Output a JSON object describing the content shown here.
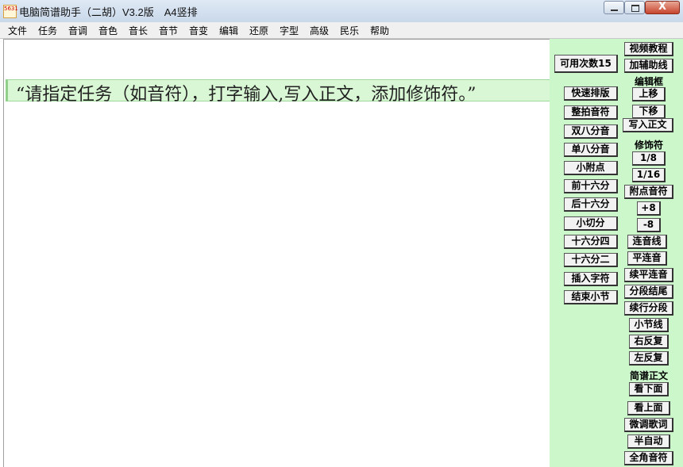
{
  "window": {
    "icon_text": "5631",
    "title": "电脑简谱助手（二胡）V3.2版　A4竖排",
    "close_glyph": "X"
  },
  "menu": [
    "文件",
    "任务",
    "音调",
    "音色",
    "音长",
    "音节",
    "音变",
    "编辑",
    "还原",
    "字型",
    "高级",
    "民乐",
    "帮助"
  ],
  "editor": {
    "prompt": "“请指定任务（如音符），打字输入,写入正文，添加修饰符。”"
  },
  "panel": {
    "left_buttons": [
      "可用次数15",
      "快速排版",
      "整拍音符",
      "双八分音",
      "单八分音",
      "小附点",
      "前十六分",
      "后十六分",
      "小切分",
      "十六分四",
      "十六分二",
      "插入字符",
      "结束小节"
    ],
    "right_items": [
      "视频教程",
      "加辅助线",
      "编辑框",
      "上移",
      "下移",
      "写入正文",
      "修饰符",
      "1/8",
      "1/16",
      "附点音符",
      "+8",
      "-8",
      "连音线",
      "平连音",
      "续平连音",
      "分段结尾",
      "续行分段",
      "小节线",
      "右反复",
      "左反复",
      "简谱正文",
      "看下面",
      "看上面",
      "微调歌词",
      "半自动",
      "全角音符"
    ]
  },
  "colors": {
    "panel_bg": "#cbf7cb",
    "highlight_bg": "#d9f7d4",
    "close_button": "#c7452e"
  }
}
